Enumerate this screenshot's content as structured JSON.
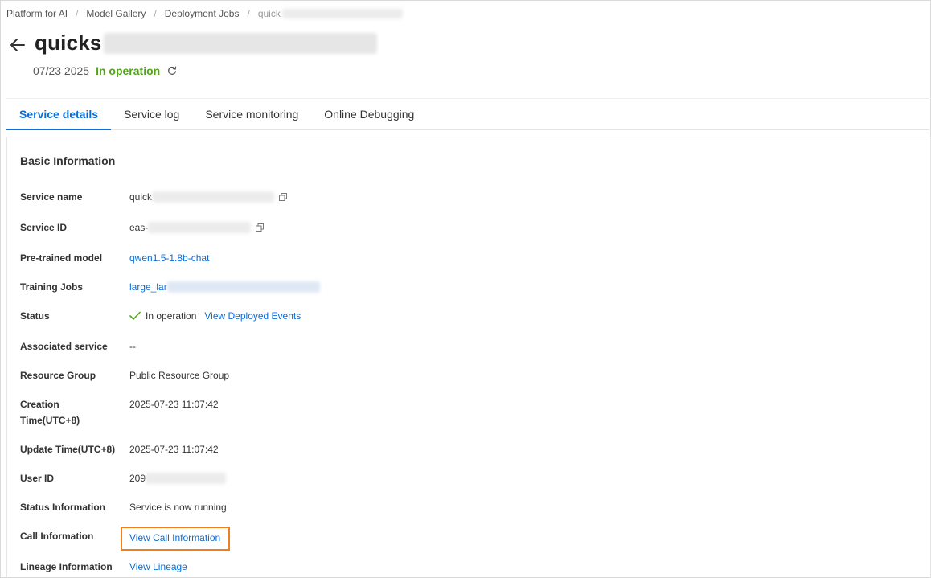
{
  "breadcrumb": {
    "items": [
      "Platform for AI",
      "Model Gallery",
      "Deployment Jobs"
    ],
    "current": "quick"
  },
  "header": {
    "title": "quicks",
    "date": "07/23 2025",
    "status": "In operation"
  },
  "tabs": [
    {
      "label": "Service details",
      "active": true
    },
    {
      "label": "Service log",
      "active": false
    },
    {
      "label": "Service monitoring",
      "active": false
    },
    {
      "label": "Online Debugging",
      "active": false
    }
  ],
  "basic_info": {
    "title": "Basic Information",
    "service_name": {
      "label": "Service name",
      "value": "quick"
    },
    "service_id": {
      "label": "Service ID",
      "value": "eas-"
    },
    "pretrained_model": {
      "label": "Pre-trained model",
      "value": "qwen1.5-1.8b-chat"
    },
    "training_jobs": {
      "label": "Training Jobs",
      "value": "large_lar"
    },
    "status": {
      "label": "Status",
      "value": "In operation",
      "link": "View Deployed Events"
    },
    "associated_service": {
      "label": "Associated service",
      "value": "--"
    },
    "resource_group": {
      "label": "Resource Group",
      "value": "Public Resource Group"
    },
    "creation_time": {
      "label_line1": "Creation",
      "label_line2": "Time(UTC+8)",
      "value": "2025-07-23 11:07:42"
    },
    "update_time": {
      "label": "Update Time(UTC+8)",
      "value": "2025-07-23 11:07:42"
    },
    "user_id": {
      "label": "User ID",
      "value": "209"
    },
    "status_information": {
      "label": "Status Information",
      "value": "Service is now running"
    },
    "call_information": {
      "label": "Call Information",
      "link": "View Call Information"
    },
    "lineage_information": {
      "label": "Lineage Information",
      "link": "View Lineage"
    }
  },
  "colors": {
    "accent": "#0a6dd6",
    "success": "#52a31a",
    "highlight": "#f07e1b"
  },
  "icons": [
    "back-arrow-icon",
    "refresh-icon",
    "copy-icon",
    "check-icon"
  ]
}
